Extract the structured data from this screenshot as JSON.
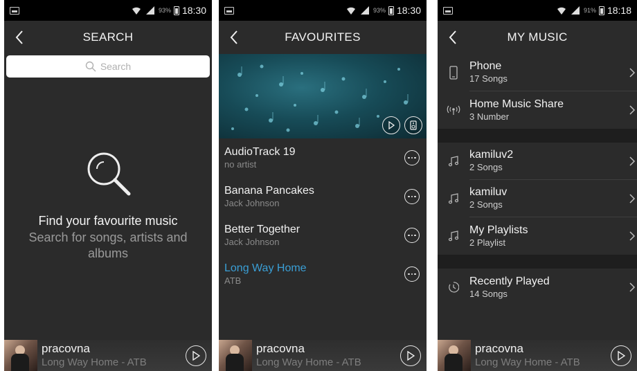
{
  "status": {
    "p1": {
      "battery": "93%",
      "time": "18:30"
    },
    "p2": {
      "battery": "93%",
      "time": "18:30"
    },
    "p3": {
      "battery": "91%",
      "time": "18:18"
    }
  },
  "search_screen": {
    "title": "SEARCH",
    "search_placeholder": "Search",
    "empty_title": "Find your favourite music",
    "empty_subtitle": "Search for songs, artists and albums"
  },
  "favourites_screen": {
    "title": "FAVOURITES",
    "tracks": [
      {
        "title": "AudioTrack 19",
        "artist": "no artist"
      },
      {
        "title": "Banana Pancakes",
        "artist": "Jack Johnson"
      },
      {
        "title": "Better Together",
        "artist": "Jack Johnson"
      },
      {
        "title": "Long Way Home",
        "artist": "ATB",
        "playing": true
      }
    ]
  },
  "my_music_screen": {
    "title": "MY MUSIC",
    "groups": [
      [
        {
          "icon": "phone-icon",
          "title": "Phone",
          "subtitle": "17 Songs"
        },
        {
          "icon": "broadcast-icon",
          "title": "Home Music Share",
          "subtitle": "3 Number"
        }
      ],
      [
        {
          "icon": "music-note-icon",
          "title": "kamiluv2",
          "subtitle": "2 Songs"
        },
        {
          "icon": "music-note-icon",
          "title": "kamiluv",
          "subtitle": "2 Songs"
        },
        {
          "icon": "music-note-icon",
          "title": "My Playlists",
          "subtitle": "2 Playlist"
        }
      ],
      [
        {
          "icon": "history-icon",
          "title": "Recently Played",
          "subtitle": "14 Songs"
        }
      ]
    ]
  },
  "now_playing": {
    "room": "pracovna",
    "track": "Long Way Home - ATB"
  },
  "colors": {
    "background": "#2b2b2b",
    "accent": "#3a9fd6",
    "status_bar": "#000000"
  }
}
